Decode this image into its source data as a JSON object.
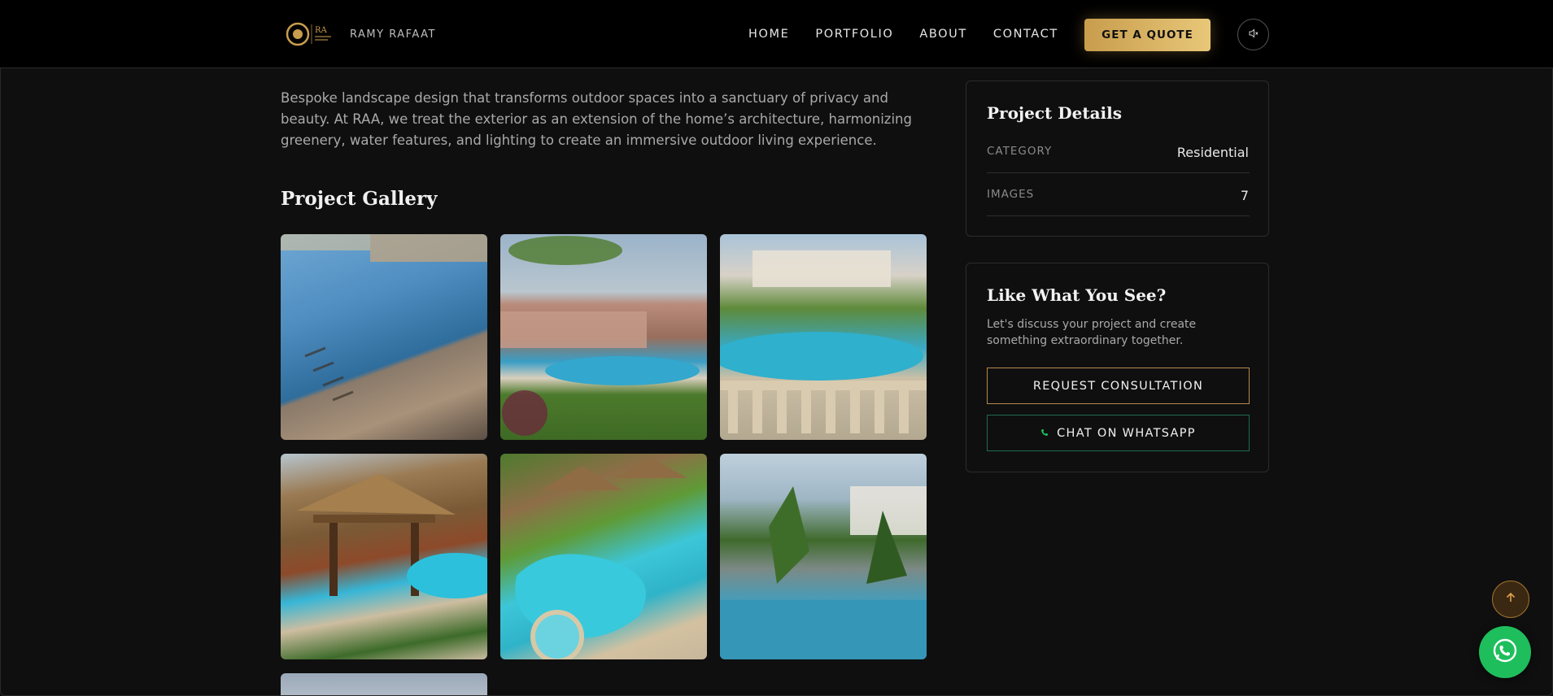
{
  "nav": {
    "brand_name": "RAMY RAFAAT",
    "logo_text": "RA",
    "items": [
      {
        "label": "HOME"
      },
      {
        "label": "PORTFOLIO"
      },
      {
        "label": "ABOUT"
      },
      {
        "label": "CONTACT"
      }
    ],
    "quote_label": "GET A QUOTE",
    "sound_icon": "speaker-muted-icon"
  },
  "main": {
    "description": "Bespoke landscape design that transforms outdoor spaces into a sanctuary of privacy and beauty. At RAA, we treat the exterior as an extension of the home’s architecture, harmonizing greenery, water features, and lighting to create an immersive outdoor living experience.",
    "gallery_title": "Project Gallery"
  },
  "details": {
    "title": "Project Details",
    "rows": [
      {
        "label": "CATEGORY",
        "value": "Residential"
      },
      {
        "label": "IMAGES",
        "value": "7"
      }
    ]
  },
  "cta": {
    "title": "Like What You See?",
    "text": "Let's discuss your project and create something extraordinary together.",
    "consult_label": "REQUEST CONSULTATION",
    "whatsapp_label": "CHAT ON WHATSAPP"
  },
  "colors": {
    "accent_gold": "#c89d4d",
    "whatsapp_green": "#1fbe5c",
    "background": "#0f0f0f"
  },
  "icons": {
    "scroll_top": "arrow-up-icon",
    "whatsapp": "whatsapp-icon",
    "phone": "phone-icon"
  }
}
